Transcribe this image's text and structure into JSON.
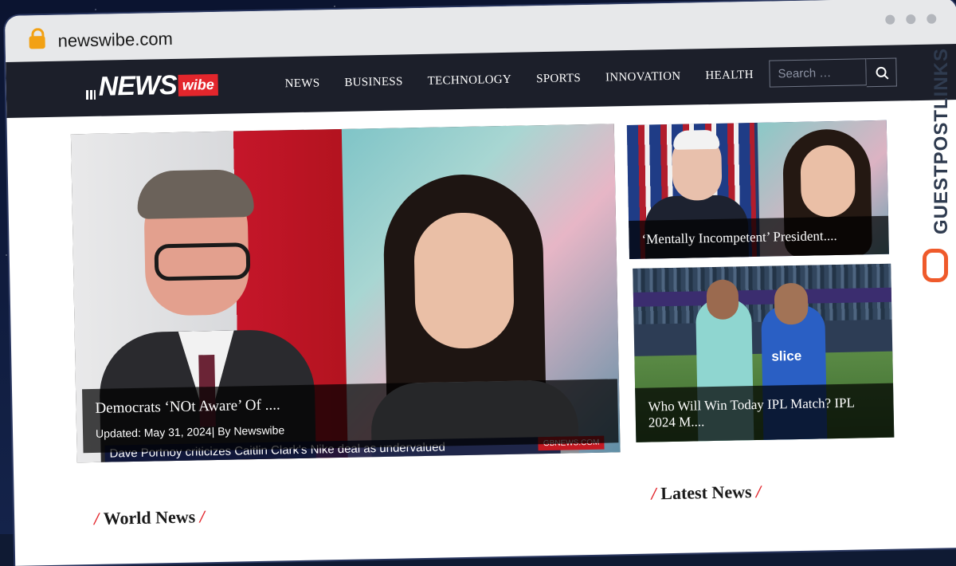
{
  "browser": {
    "url": "newswibe.com"
  },
  "logo": {
    "news": "NEWS",
    "wibe": "wibe"
  },
  "nav": {
    "items": [
      "NEWS",
      "BUSINESS",
      "TECHNOLOGY",
      "SPORTS",
      "INNOVATION",
      "HEALTH"
    ]
  },
  "search": {
    "placeholder": "Search …"
  },
  "feature": {
    "title": "Democrats ‘NOt Aware’ Of ....",
    "meta": "Updated: May 31, 2024| By Newswibe",
    "ticker": "Dave Portnoy criticizes Caitlin Clark's Nike deal as undervalued",
    "brand": "GBNEWS.COM"
  },
  "side_cards": [
    {
      "title": "‘Mentally Incompetent’ President...."
    },
    {
      "title": "Who Will Win Today IPL Match? IPL 2024 M....",
      "shirt": "slice"
    }
  ],
  "sections": {
    "world": "World News",
    "latest": "Latest News"
  },
  "watermark": "GUESTPOSTLINKS",
  "colors": {
    "accent": "#e3262c",
    "nav_bg": "#1c1f2a"
  }
}
